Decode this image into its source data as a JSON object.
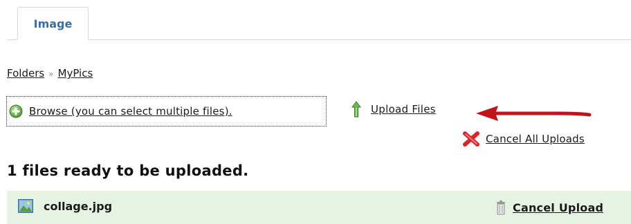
{
  "tabs": [
    {
      "label": "Image",
      "active": true
    }
  ],
  "breadcrumb": {
    "items": [
      "Folders",
      "MyPics"
    ],
    "separator": "»"
  },
  "toolbar": {
    "browse_label": "Browse (you can select multiple files).",
    "browse_icon": "green-plus-circle-icon",
    "upload_label": "Upload Files",
    "upload_icon": "green-up-arrow-icon",
    "cancel_all_label": "Cancel All Uploads",
    "cancel_all_icon": "red-x-icon"
  },
  "annotation": {
    "arrow_color": "#c0141b",
    "points_to": "upload-files-button"
  },
  "queue": {
    "heading": "1 files ready to be uploaded.",
    "files": [
      {
        "name": "collage.jpg",
        "icon": "image-file-icon",
        "cancel_label": "Cancel Upload",
        "cancel_icon": "trash-can-icon"
      }
    ]
  },
  "colors": {
    "tab_text": "#3b6fa0",
    "file_row_bg": "#e6f2e2",
    "annotation_arrow": "#c0141b"
  }
}
